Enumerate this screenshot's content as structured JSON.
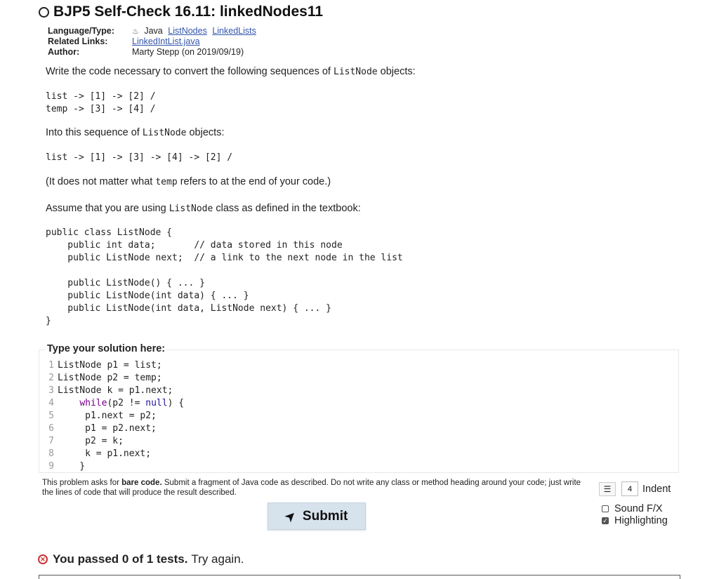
{
  "title": "BJP5 Self-Check 16.11: linkedNodes11",
  "meta": {
    "language_label": "Language/Type:",
    "language_value": "Java",
    "language_tags": [
      "ListNodes",
      "LinkedLists"
    ],
    "related_label": "Related Links:",
    "related_link": "LinkedIntList.java",
    "author_label": "Author:",
    "author_value": "Marty Stepp (on 2019/09/19)"
  },
  "prompt": {
    "intro_before": "Write the code necessary to convert the following sequences of ",
    "intro_code": "ListNode",
    "intro_after": " objects:",
    "seq1": "list -> [1] -> [2] /\ntemp -> [3] -> [4] /",
    "into_before": "Into this sequence of ",
    "into_code": "ListNode",
    "into_after": " objects:",
    "seq2": "list -> [1] -> [3] -> [4] -> [2] /",
    "note_before": "(It does not matter what ",
    "note_code": "temp",
    "note_after": " refers to at the end of your code.)",
    "assume_before": "Assume that you are using ",
    "assume_code": "ListNode",
    "assume_after": " class as defined in the textbook:",
    "class_code": "public class ListNode {\n    public int data;       // data stored in this node\n    public ListNode next;  // a link to the next node in the list\n\n    public ListNode() { ... }\n    public ListNode(int data) { ... }\n    public ListNode(int data, ListNode next) { ... }\n}"
  },
  "editor": {
    "legend": "Type your solution here:",
    "lines": [
      {
        "n": "1",
        "text": "ListNode p1 = list;"
      },
      {
        "n": "2",
        "text": "ListNode p2 = temp;"
      },
      {
        "n": "3",
        "text": "ListNode k = p1.next;"
      },
      {
        "n": "4",
        "indent": "    ",
        "kw": "while",
        "mid": "(p2 != ",
        "atom": "null",
        "rest": ") {"
      },
      {
        "n": "5",
        "text": "     p1.next = p2;"
      },
      {
        "n": "6",
        "text": "     p1 = p2.next;"
      },
      {
        "n": "7",
        "text": "     p2 = k;"
      },
      {
        "n": "8",
        "text": "     k = p1.next;"
      },
      {
        "n": "9",
        "text": "    }"
      }
    ]
  },
  "instructions": {
    "before": "This problem asks for ",
    "bold": "bare code.",
    "after": " Submit a fragment of Java code as described. Do not write any class or method heading around your code; just write the lines of code that will produce the result described."
  },
  "submit_label": "Submit",
  "indent": {
    "value": "4",
    "label": "Indent"
  },
  "options": {
    "sound_label": "Sound F/X",
    "sound_checked": false,
    "highlight_label": "Highlighting",
    "highlight_checked": true
  },
  "result": {
    "bold": "You passed 0 of 1 tests.",
    "rest": "Try again."
  }
}
